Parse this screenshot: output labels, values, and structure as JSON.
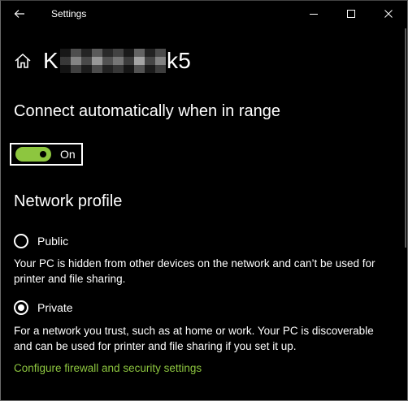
{
  "window": {
    "title": "Settings"
  },
  "header": {
    "network_name_prefix": "K",
    "network_name_suffix": "k5"
  },
  "connect": {
    "heading": "Connect automatically when in range",
    "toggle_label": "On",
    "toggle_on": true
  },
  "profile": {
    "heading": "Network profile",
    "options": [
      {
        "label": "Public",
        "selected": false,
        "description": "Your PC is hidden from other devices on the network and can’t be used for printer and file sharing."
      },
      {
        "label": "Private",
        "selected": true,
        "description": "For a network you trust, such as at home or work. Your PC is discoverable and can be used for printer and file sharing if you set it up."
      }
    ],
    "link": "Configure firewall and security settings"
  },
  "colors": {
    "accent": "#8dc63f",
    "background": "#000000",
    "text": "#ffffff"
  },
  "icons": {
    "back": "back-arrow-icon",
    "home": "home-icon",
    "minimize": "minimize-icon",
    "maximize": "maximize-icon",
    "close": "close-icon"
  }
}
